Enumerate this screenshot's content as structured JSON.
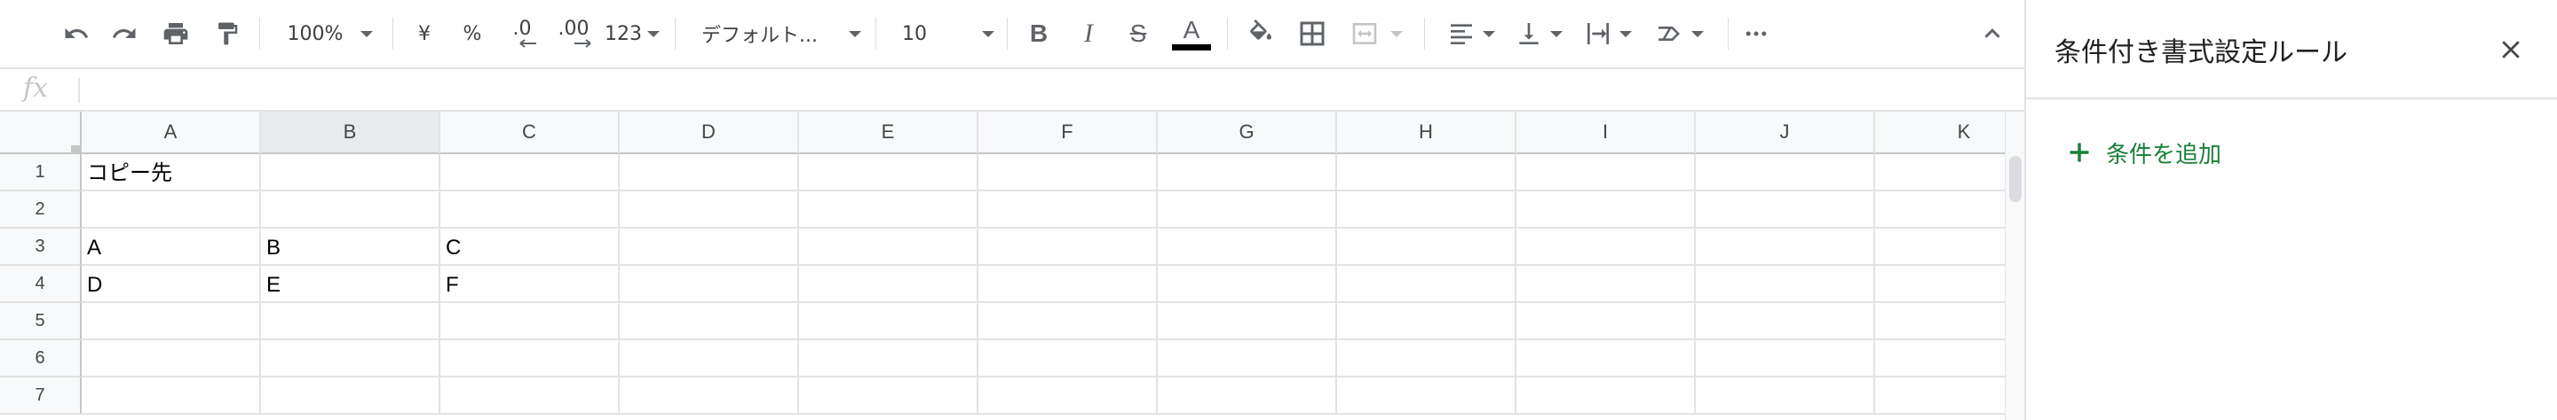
{
  "toolbar": {
    "undo_icon": "undo-icon",
    "redo_icon": "redo-icon",
    "print_icon": "print-icon",
    "paint_format_icon": "paint-format-icon",
    "zoom": "100%",
    "currency": "¥",
    "percent": "%",
    "decrease_decimal": ".0",
    "increase_decimal": ".00",
    "more_formats": "123",
    "font": "デフォルト...",
    "font_size": "10",
    "bold": "B",
    "italic": "I",
    "strikethrough": "S",
    "text_color_label": "A",
    "text_color": "#000000"
  },
  "formula_bar": {
    "fx_label": "fx",
    "value": ""
  },
  "grid": {
    "columns": [
      "A",
      "B",
      "C",
      "D",
      "E",
      "F",
      "G",
      "H",
      "I",
      "J",
      "K"
    ],
    "selected_column": "B",
    "rows": [
      "1",
      "2",
      "3",
      "4",
      "5",
      "6",
      "7"
    ],
    "cells": {
      "A1": "コピー先",
      "A3": "A",
      "B3": "B",
      "C3": "C",
      "A4": "D",
      "B4": "E",
      "C4": "F"
    }
  },
  "panel": {
    "title": "条件付き書式設定ルール",
    "close_icon": "close-icon",
    "add_rule_label": "条件を追加",
    "accent_color": "#188038"
  }
}
